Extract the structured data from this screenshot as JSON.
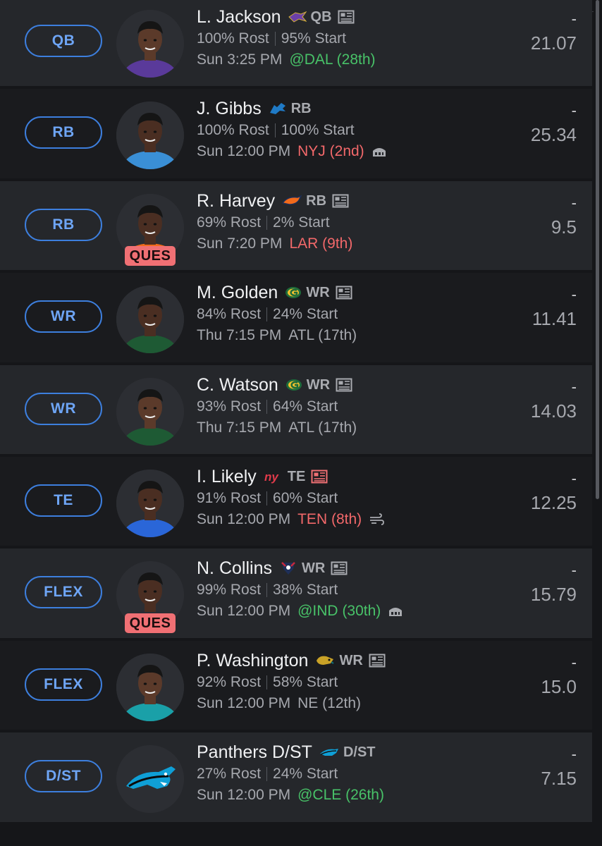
{
  "colors": {
    "accent": "#3d7fde",
    "good": "#48c268",
    "bad": "#f2686a",
    "injury": "#f07074"
  },
  "roster": [
    {
      "slot": "QB",
      "name": "L. Jackson",
      "team_icon": "ravens-logo-icon",
      "team_color": "#6b3fa8",
      "pos": "QB",
      "news": "news-icon",
      "news_alert": false,
      "rost": "100% Rost",
      "start": "95% Start",
      "day": "Sun",
      "time": "3:25 PM",
      "opp": "@DAL",
      "rank": "(28th)",
      "matchup": "good",
      "weather": null,
      "status": "",
      "dash": "-",
      "score": "21.07",
      "jersey": "#5a3a9a",
      "skin": "#5b3a2a"
    },
    {
      "slot": "RB",
      "name": "J. Gibbs",
      "team_icon": "lions-logo-icon",
      "team_color": "#1f7ac6",
      "pos": "RB",
      "news": null,
      "news_alert": false,
      "rost": "100% Rost",
      "start": "100% Start",
      "day": "Sun",
      "time": "12:00 PM",
      "opp": "NYJ",
      "rank": "(2nd)",
      "matchup": "bad",
      "weather": "stadium-icon",
      "status": "",
      "dash": "-",
      "score": "25.34",
      "jersey": "#3a8fd6",
      "skin": "#4a2e22"
    },
    {
      "slot": "RB",
      "name": "R. Harvey",
      "team_icon": "broncos-logo-icon",
      "team_color": "#f26a1b",
      "pos": "RB",
      "news": "news-icon",
      "news_alert": false,
      "rost": "69% Rost",
      "start": "2% Start",
      "day": "Sun",
      "time": "7:20 PM",
      "opp": "LAR",
      "rank": "(9th)",
      "matchup": "bad",
      "weather": null,
      "status": "QUES",
      "dash": "-",
      "score": "9.5",
      "jersey": "#f26a1b",
      "skin": "#4a2e22"
    },
    {
      "slot": "WR",
      "name": "M. Golden",
      "team_icon": "packers-logo-icon",
      "team_color": "#1e6b3a",
      "pos": "WR",
      "news": "news-icon",
      "news_alert": false,
      "rost": "84% Rost",
      "start": "24% Start",
      "day": "Thu",
      "time": "7:15 PM",
      "opp": "ATL",
      "rank": "(17th)",
      "matchup": "neutral",
      "weather": null,
      "status": "",
      "dash": "-",
      "score": "11.41",
      "jersey": "#1e5a34",
      "skin": "#4a2e22"
    },
    {
      "slot": "WR",
      "name": "C. Watson",
      "team_icon": "packers-logo-icon",
      "team_color": "#1e6b3a",
      "pos": "WR",
      "news": "news-icon",
      "news_alert": false,
      "rost": "93% Rost",
      "start": "64% Start",
      "day": "Thu",
      "time": "7:15 PM",
      "opp": "ATL",
      "rank": "(17th)",
      "matchup": "neutral",
      "weather": null,
      "status": "",
      "dash": "-",
      "score": "14.03",
      "jersey": "#1e5a34",
      "skin": "#5b3a2a"
    },
    {
      "slot": "TE",
      "name": "I. Likely",
      "team_icon": "giants-logo-icon",
      "team_color": "#e03a4a",
      "pos": "TE",
      "news": "news-icon",
      "news_alert": true,
      "rost": "91% Rost",
      "start": "60% Start",
      "day": "Sun",
      "time": "12:00 PM",
      "opp": "TEN",
      "rank": "(8th)",
      "matchup": "bad",
      "weather": "wind-icon",
      "status": "",
      "dash": "-",
      "score": "12.25",
      "jersey": "#2a66d8",
      "skin": "#4a2e22"
    },
    {
      "slot": "FLEX",
      "name": "N. Collins",
      "team_icon": "texans-logo-icon",
      "team_color": "#c8283c",
      "pos": "WR",
      "news": "news-icon",
      "news_alert": false,
      "rost": "99% Rost",
      "start": "38% Start",
      "day": "Sun",
      "time": "12:00 PM",
      "opp": "@IND",
      "rank": "(30th)",
      "matchup": "good",
      "weather": "stadium-icon",
      "status": "QUES",
      "dash": "-",
      "score": "15.79",
      "jersey": "#2a2c34",
      "skin": "#4a2e22"
    },
    {
      "slot": "FLEX",
      "name": "P. Washington",
      "team_icon": "jaguars-logo-icon",
      "team_color": "#c9a227",
      "pos": "WR",
      "news": "news-icon",
      "news_alert": false,
      "rost": "92% Rost",
      "start": "58% Start",
      "day": "Sun",
      "time": "12:00 PM",
      "opp": "NE",
      "rank": "(12th)",
      "matchup": "neutral",
      "weather": null,
      "status": "",
      "dash": "-",
      "score": "15.0",
      "jersey": "#1aa0a8",
      "skin": "#5b3a2a"
    },
    {
      "slot": "D/ST",
      "name": "Panthers D/ST",
      "team_icon": "panthers-logo-icon",
      "team_color": "#0f9fd6",
      "pos": "D/ST",
      "news": null,
      "news_alert": false,
      "rost": "27% Rost",
      "start": "24% Start",
      "day": "Sun",
      "time": "12:00 PM",
      "opp": "@CLE",
      "rank": "(26th)",
      "matchup": "good",
      "weather": null,
      "status": "",
      "dash": "-",
      "score": "7.15",
      "jersey": "",
      "skin": "",
      "is_team": true
    }
  ]
}
